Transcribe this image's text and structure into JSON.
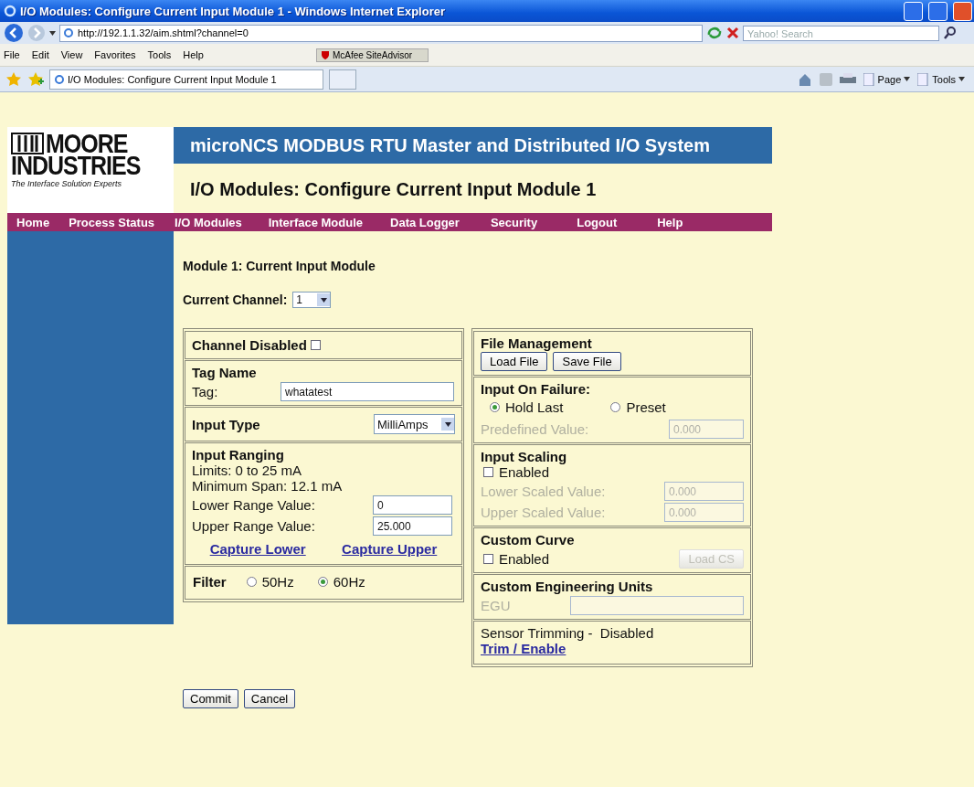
{
  "browser": {
    "title": "I/O Modules: Configure Current Input Module 1 - Windows Internet Explorer",
    "url": "http://192.1.1.32/aim.shtml?channel=0",
    "search_placeholder": "Yahoo! Search",
    "menu": [
      "File",
      "Edit",
      "View",
      "Favorites",
      "Tools",
      "Help"
    ],
    "addon": "McAfee SiteAdvisor",
    "tab": "I/O Modules: Configure Current Input Module 1",
    "commands": [
      "Page",
      "Tools"
    ]
  },
  "logo": {
    "line1": "MOORE",
    "line2": "INDUSTRIES",
    "tagline": "The Interface Solution Experts"
  },
  "system_title": "microNCS MODBUS RTU Master and Distributed I/O System",
  "page_title": "I/O Modules: Configure Current Input Module 1",
  "nav": [
    "Home",
    "Process Status",
    "I/O Modules",
    "Interface Module",
    "Data Logger",
    "Security",
    "Logout",
    "Help"
  ],
  "module_heading": "Module 1: Current Input Module",
  "channel": {
    "label": "Current Channel:",
    "value": "1"
  },
  "channel_disabled": {
    "label": "Channel Disabled",
    "checked": false
  },
  "tag_name": {
    "heading": "Tag Name",
    "label": "Tag:",
    "value": "whatatest"
  },
  "input_type": {
    "label": "Input Type",
    "value": "MilliAmps"
  },
  "input_ranging": {
    "heading": "Input Ranging",
    "limits": "Limits: 0 to 25 mA",
    "min_span": "Minimum Span: 12.1 mA",
    "fields": [
      {
        "label": "Lower Range Value:",
        "value": "0"
      },
      {
        "label": "Upper Range Value:",
        "value": "25.000"
      }
    ],
    "links": [
      "Capture Lower",
      "Capture Upper"
    ]
  },
  "filter": {
    "label": "Filter",
    "options": [
      {
        "label": "50Hz",
        "selected": false
      },
      {
        "label": "60Hz",
        "selected": true
      }
    ]
  },
  "file_management": {
    "heading": "File Management",
    "buttons": [
      "Load File",
      "Save File"
    ]
  },
  "input_on_failure": {
    "heading": "Input On Failure:",
    "options": [
      {
        "label": "Hold Last",
        "selected": true
      },
      {
        "label": "Preset",
        "selected": false
      }
    ],
    "field": {
      "label": "Predefined Value:",
      "value": "0.000",
      "disabled": true
    }
  },
  "input_scaling": {
    "heading": "Input Scaling",
    "enabled": {
      "label": "Enabled",
      "checked": false
    },
    "fields": [
      {
        "label": "Lower Scaled Value:",
        "value": "0.000",
        "disabled": true
      },
      {
        "label": "Upper Scaled Value:",
        "value": "0.000",
        "disabled": true
      }
    ]
  },
  "custom_curve": {
    "heading": "Custom Curve",
    "enabled": {
      "label": "Enabled",
      "checked": false
    },
    "button": {
      "label": "Load CS",
      "disabled": true
    }
  },
  "custom_units": {
    "heading": "Custom Engineering Units",
    "field": {
      "label": "EGU",
      "disabled": true
    }
  },
  "sensor_trimming": {
    "status": "Sensor Trimming -  Disabled",
    "link": "Trim / Enable"
  },
  "buttons": [
    "Commit",
    "Cancel"
  ]
}
